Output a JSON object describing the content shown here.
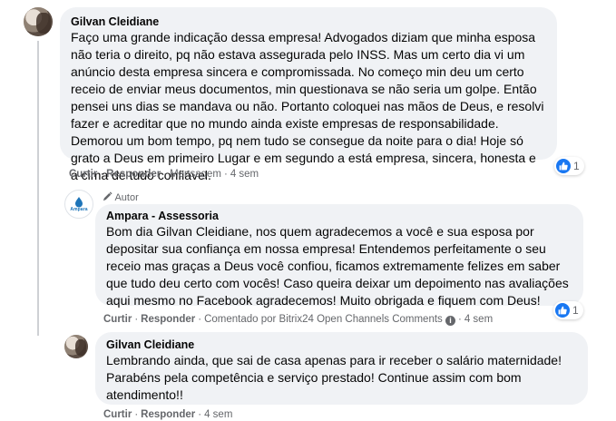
{
  "comments": [
    {
      "author": "Gilvan Cleidiane",
      "text": "Faço uma grande indicação dessa empresa! Advogados diziam que minha esposa não teria o direito, pq não estava assegurada pelo INSS. Mas um certo dia vi um anúncio desta empresa sincera e compromissada. No começo min deu um certo receio de enviar meus documentos, min questionava se não seria um golpe. Então pensei uns dias se mandava ou não. Portanto coloquei nas mãos de Deus, e resolvi fazer e acreditar que no mundo ainda existe empresas de responsabilidade. Demorou um bom tempo, pq nem tudo se consegue da noite para o dia! Hoje só grato a Deus em primeiro Lugar e em segundo a está empresa, sincera, honesta e a cima de tudo confiável.",
      "actions": {
        "like": "Curtir",
        "reply": "Responder",
        "type": "Mensagem",
        "time": "4 sem"
      },
      "reaction_count": "1"
    },
    {
      "badge": "Autor",
      "author": "Ampara - Assessoria",
      "logo_text": "Ampara",
      "text": "Bom dia Gilvan Cleidiane, nos quem agradecemos a você e sua esposa por depositar sua confiança em nossa empresa! Entendemos perfeitamente o seu receio mas graças a Deus você confiou, ficamos extremamente felizes em saber que tudo deu certo com vocês! Caso queira deixar um depoimento nas avaliações aqui mesmo no Facebook agradecemos! Muito obrigada e fiquem com Deus!",
      "actions": {
        "like": "Curtir",
        "reply": "Responder",
        "commented_by": "Comentado por Bitrix24 Open Channels Comments",
        "time": "4 sem"
      },
      "reaction_count": "1"
    },
    {
      "author": "Gilvan Cleidiane",
      "text": "Lembrando ainda, que sai de casa apenas para ir receber o salário maternidade! Parabéns pela competência e serviço prestado! Continue assim com bom atendimento!!",
      "actions": {
        "like": "Curtir",
        "reply": "Responder",
        "time": "4 sem"
      }
    }
  ],
  "colors": {
    "bubble": "#f0f2f5",
    "meta": "#65676b",
    "like_blue": "#1877f2"
  }
}
